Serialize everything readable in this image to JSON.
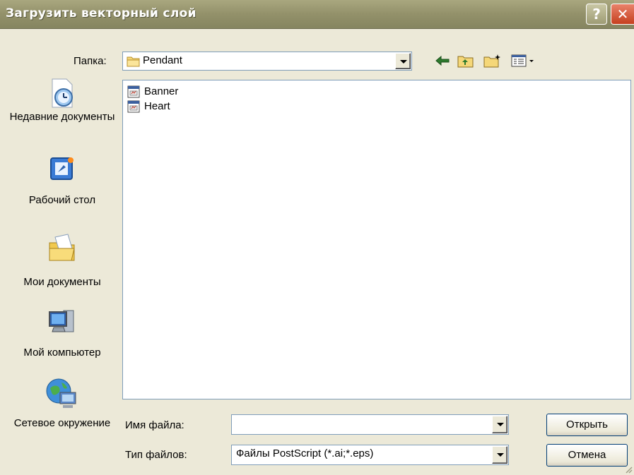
{
  "window": {
    "title": "Загрузить векторный слой"
  },
  "title_buttons": {
    "help": "?",
    "close": "✕"
  },
  "lookin": {
    "label": "Папка:",
    "value": "Pendant"
  },
  "toolbar": {
    "back_icon": "back-arrow-icon",
    "up_icon": "up-folder-icon",
    "new_folder_icon": "new-folder-icon",
    "view_menu_icon": "view-menu-icon"
  },
  "places": [
    {
      "label": "Недавние документы",
      "icon": "recent-documents-icon"
    },
    {
      "label": "Рабочий стол",
      "icon": "desktop-icon"
    },
    {
      "label": "Мои документы",
      "icon": "my-documents-icon"
    },
    {
      "label": "Мой компьютер",
      "icon": "my-computer-icon"
    },
    {
      "label": "Сетевое окружение",
      "icon": "network-places-icon"
    }
  ],
  "files": [
    {
      "name": "Banner",
      "icon": "vector-file-icon"
    },
    {
      "name": "Heart",
      "icon": "vector-file-icon"
    }
  ],
  "filename": {
    "label": "Имя файла:",
    "value": ""
  },
  "filetype": {
    "label": "Тип файлов:",
    "value": "Файлы PostScript (*.ai;*.eps)"
  },
  "buttons": {
    "open": "Открыть",
    "cancel": "Отмена"
  },
  "colors": {
    "titlebar": "#93916a",
    "dialog_bg": "#ece9d8",
    "close": "#c5401f",
    "border": "#7f9db9"
  }
}
